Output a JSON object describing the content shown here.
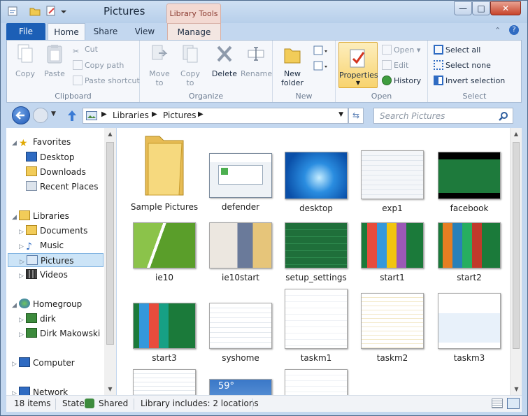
{
  "window": {
    "title": "Pictures",
    "context_tab": "Library Tools"
  },
  "tabs": [
    {
      "label": "File"
    },
    {
      "label": "Home"
    },
    {
      "label": "Share"
    },
    {
      "label": "View"
    },
    {
      "label": "Manage"
    }
  ],
  "ribbon": {
    "clipboard": {
      "label": "Clipboard",
      "copy": "Copy",
      "paste": "Paste",
      "cut": "Cut",
      "copy_path": "Copy path",
      "paste_shortcut": "Paste shortcut"
    },
    "organize": {
      "label": "Organize",
      "move_to": "Move",
      "move_to2": "to",
      "copy_to": "Copy",
      "copy_to2": "to",
      "delete": "Delete",
      "rename": "Rename"
    },
    "new": {
      "label": "New",
      "new_folder": "New",
      "new_folder2": "folder"
    },
    "open": {
      "label": "Open",
      "properties": "Properties",
      "open": "Open",
      "edit": "Edit",
      "history": "History"
    },
    "select": {
      "label": "Select",
      "select_all": "Select all",
      "select_none": "Select none",
      "invert": "Invert selection"
    }
  },
  "address": {
    "crumbs": [
      "Libraries",
      "Pictures"
    ],
    "search_placeholder": "Search Pictures"
  },
  "nav": {
    "favorites": {
      "label": "Favorites",
      "items": [
        "Desktop",
        "Downloads",
        "Recent Places"
      ]
    },
    "libraries": {
      "label": "Libraries",
      "items": [
        "Documents",
        "Music",
        "Pictures",
        "Videos"
      ]
    },
    "homegroup": {
      "label": "Homegroup",
      "items": [
        "dirk",
        "Dirk Makowski"
      ]
    },
    "computer": "Computer",
    "network": "Network"
  },
  "files": [
    {
      "name": "Sample Pictures"
    },
    {
      "name": "defender"
    },
    {
      "name": "desktop"
    },
    {
      "name": "exp1"
    },
    {
      "name": "facebook"
    },
    {
      "name": "ie10"
    },
    {
      "name": "ie10start"
    },
    {
      "name": "setup_settings"
    },
    {
      "name": "start1"
    },
    {
      "name": "start2"
    },
    {
      "name": "start3"
    },
    {
      "name": "syshome"
    },
    {
      "name": "taskm1"
    },
    {
      "name": "taskm2"
    },
    {
      "name": "taskm3"
    }
  ],
  "partial": {
    "temp": "59°"
  },
  "status": {
    "count": "18 items",
    "state_label": "State:",
    "state_value": "Shared",
    "library": "Library includes: 2 locations"
  },
  "colors": {
    "accent": "#1c5fb6",
    "properties_highlight": "#f8d36e",
    "selection": "#cce4f7"
  }
}
